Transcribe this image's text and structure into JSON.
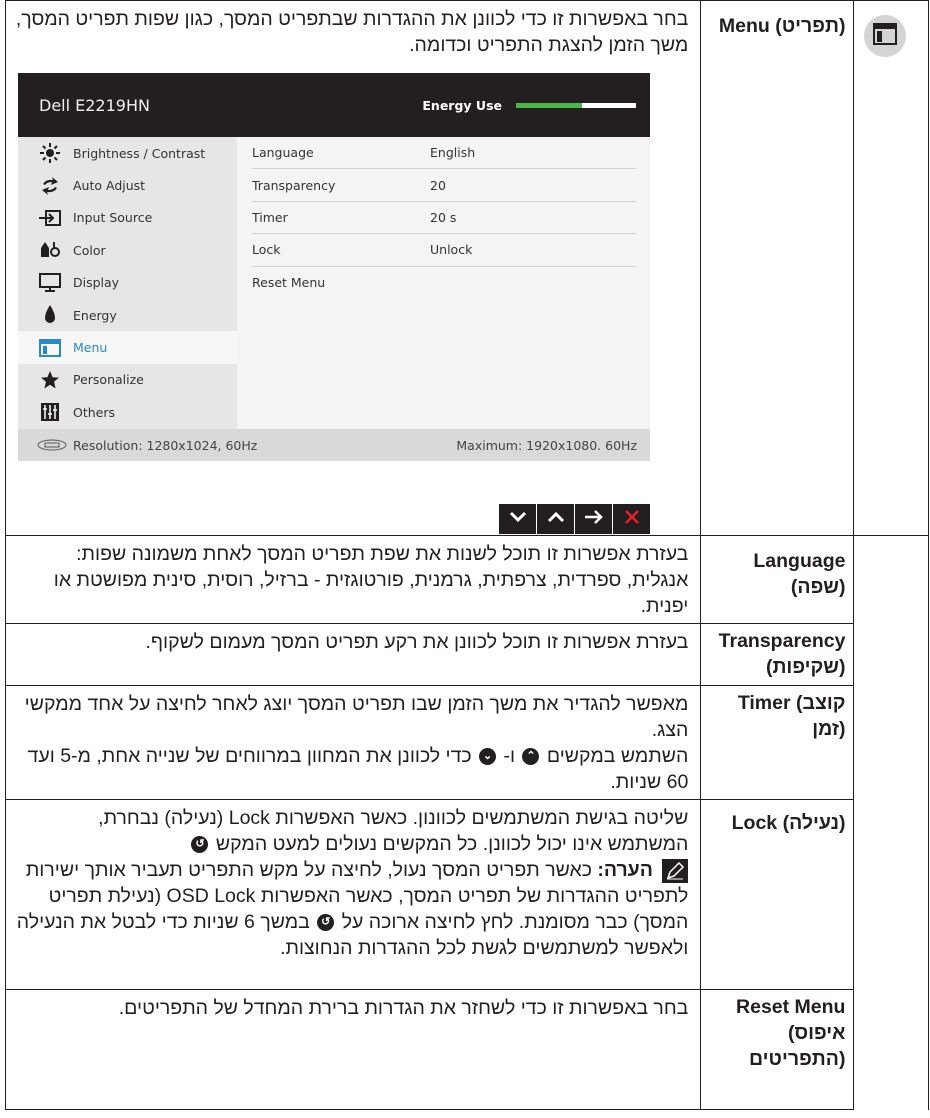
{
  "menu_row": {
    "feature": "Menu (תפריט)",
    "description": "בחר באפשרות זו כדי לכוונן את ההגדרות שבתפריט המסך, כגון שפות תפריט המסך, משך הזמן להצגת התפריט וכדומה."
  },
  "osd": {
    "model": "Dell E2219HN",
    "energy_label": "Energy Use",
    "energy_level_fraction": 0.55,
    "sidebar": [
      {
        "label": "Brightness / Contrast",
        "icon": "brightness-icon"
      },
      {
        "label": "Auto Adjust",
        "icon": "auto-adjust-icon"
      },
      {
        "label": "Input Source",
        "icon": "input-source-icon"
      },
      {
        "label": "Color",
        "icon": "color-icon"
      },
      {
        "label": "Display",
        "icon": "display-icon"
      },
      {
        "label": "Energy",
        "icon": "energy-icon"
      },
      {
        "label": "Menu",
        "icon": "menu-icon"
      },
      {
        "label": "Personalize",
        "icon": "star-icon"
      },
      {
        "label": "Others",
        "icon": "others-icon"
      }
    ],
    "settings": [
      {
        "name": "Language",
        "value": "English"
      },
      {
        "name": "Transparency",
        "value": "20"
      },
      {
        "name": "Timer",
        "value": "20 s"
      },
      {
        "name": "Lock",
        "value": "Unlock"
      },
      {
        "name": "Reset Menu",
        "value": ""
      }
    ],
    "footer_left": "Resolution: 1280x1024, 60Hz",
    "footer_right": "Maximum: 1920x1080. 60Hz"
  },
  "language_row": {
    "feature": "Language (שפה)",
    "description": "בעזרת אפשרות זו תוכל לשנות את שפת תפריט המסך לאחת משמונה שפות: אנגלית, ספרדית, צרפתית, גרמנית, פורטוגזית - ברזיל, רוסית, סינית מפושטת או יפנית."
  },
  "transparency_row": {
    "feature": "Transparency (שקיפות)",
    "description": "בעזרת אפשרות זו תוכל לכוונן את רקע תפריט המסך מעמום לשקוף."
  },
  "timer_row": {
    "feature": "Timer (קוצב זמן)",
    "line1": "מאפשר להגדיר את משך הזמן שבו תפריט המסך יוצג לאחר לחיצה על אחד ממקשי הצג.",
    "line2_a": "השתמש במקשים",
    "line2_b": "ו-",
    "line2_c": "כדי לכוונן את המחוון במרווחים של שנייה אחת, מ-5 ועד 60 שניות."
  },
  "lock_row": {
    "feature": "Lock (נעילה)",
    "para1": "שליטה בגישת המשתמשים לכוונון. כאשר האפשרות Lock (נעילה) נבחרת, המשתמש אינו יכול לכוונן. כל המקשים נעולים למעט המקש",
    "note_label": "הערה:",
    "note_text": "כאשר תפריט המסך נעול, לחיצה על מקש התפריט תעביר אותך ישירות לתפריט ההגדרות של תפריט המסך, כאשר האפשרות OSD Lock (נעילת תפריט המסך) כבר מסומנת. לחץ לחיצה ארוכה על",
    "note_text2": "במשך 6 שניות כדי לבטל את הנעילה ולאפשר למשתמשים לגשת לכל ההגדרות הנחוצות."
  },
  "reset_row": {
    "feature": "Reset Menu (איפוס התפריטים)",
    "description": "בחר באפשרות זו כדי לשחזר את הגדרות ברירת המחדל של התפריטים."
  }
}
